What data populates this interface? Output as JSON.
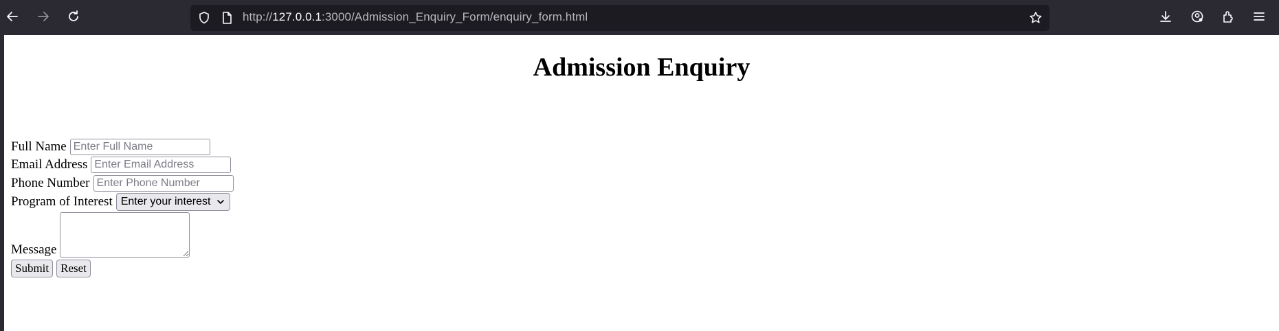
{
  "browser": {
    "url_prefix": "http://",
    "url_host": "127.0.0.1",
    "url_rest": ":3000/Admission_Enquiry_Form/enquiry_form.html",
    "icons": [
      "back-icon",
      "forward-icon",
      "reload-icon",
      "shield-icon",
      "page-icon",
      "bookmark-star-icon",
      "download-icon",
      "account-icon",
      "extensions-icon",
      "menu-icon"
    ]
  },
  "page": {
    "title": "Admission Enquiry"
  },
  "form": {
    "full_name": {
      "label": "Full Name",
      "placeholder": "Enter Full Name",
      "value": ""
    },
    "email": {
      "label": "Email Address",
      "placeholder": "Enter Email Address",
      "value": ""
    },
    "phone": {
      "label": "Phone Number",
      "placeholder": "Enter Phone Number",
      "value": ""
    },
    "program": {
      "label": "Program of Interest",
      "selected": "Enter your interest"
    },
    "message": {
      "label": "Message",
      "value": ""
    },
    "submit_label": "Submit",
    "reset_label": "Reset"
  }
}
